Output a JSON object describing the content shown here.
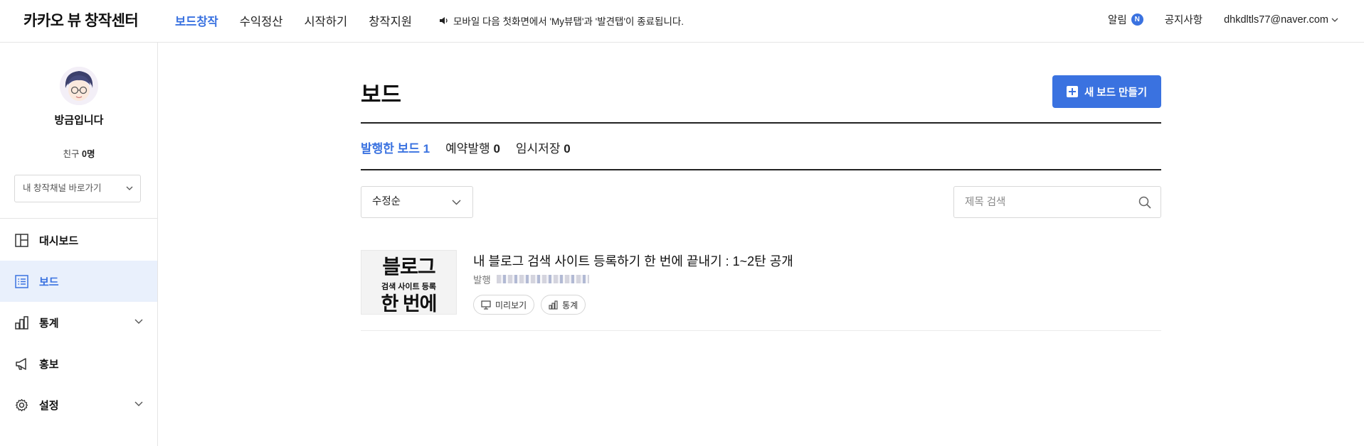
{
  "header": {
    "logo": "카카오 뷰 창작센터",
    "nav": [
      "보드창작",
      "수익정산",
      "시작하기",
      "창작지원"
    ],
    "notice": "모바일 다음 첫화면에서 'My뷰탭'과 '발견탭'이 종료됩니다.",
    "alarm_label": "알림",
    "alarm_badge": "N",
    "notice_link": "공지사항",
    "account": "dhkdltls77@naver.com"
  },
  "sidebar": {
    "profile_name": "방금입니다",
    "friends_label": "친구",
    "friends_count": "0명",
    "channel_select": "내 창작채널 바로가기",
    "menu": [
      {
        "label": "대시보드",
        "icon": "dashboard-icon"
      },
      {
        "label": "보드",
        "icon": "board-list-icon"
      },
      {
        "label": "통계",
        "icon": "bar-chart-icon"
      },
      {
        "label": "홍보",
        "icon": "megaphone-icon"
      },
      {
        "label": "설정",
        "icon": "gear-icon"
      }
    ]
  },
  "main": {
    "title": "보드",
    "new_board_button": "새 보드 만들기",
    "tabs": [
      {
        "label": "발행한 보드",
        "count": "1"
      },
      {
        "label": "예약발행",
        "count": "0"
      },
      {
        "label": "임시저장",
        "count": "0"
      }
    ],
    "sort": "수정순",
    "search_placeholder": "제목 검색",
    "boards": [
      {
        "thumb_line1": "블로그",
        "thumb_line2": "검색 사이트 등록",
        "thumb_line3": "한 번에",
        "title": "내 블로그 검색 사이트 등록하기 한 번에 끝내기 : 1~2탄 공개",
        "status": "발행",
        "preview_label": "미리보기",
        "stats_label": "통계"
      }
    ]
  },
  "colors": {
    "accent": "#3a72e0",
    "active_bg": "#e9f0fc"
  }
}
